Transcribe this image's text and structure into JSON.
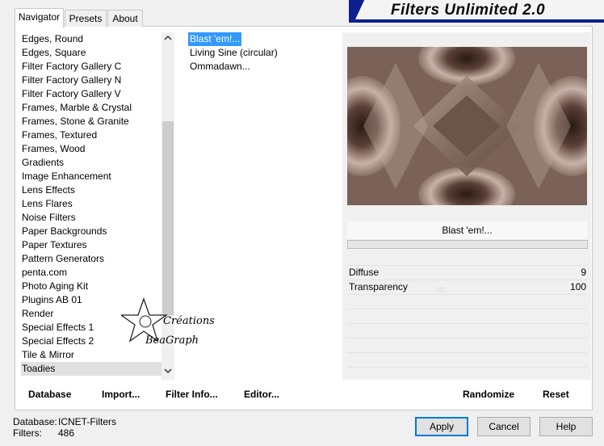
{
  "banner": {
    "title": "Filters Unlimited 2.0"
  },
  "tabs": [
    {
      "label": "Navigator",
      "active": true
    },
    {
      "label": "Presets",
      "active": false
    },
    {
      "label": "About",
      "active": false
    }
  ],
  "categories": [
    "Edges, Round",
    "Edges, Square",
    "Filter Factory Gallery C",
    "Filter Factory Gallery N",
    "Filter Factory Gallery V",
    "Frames, Marble & Crystal",
    "Frames, Stone & Granite",
    "Frames, Textured",
    "Frames, Wood",
    "Gradients",
    "Image Enhancement",
    "Lens Effects",
    "Lens Flares",
    "Noise Filters",
    "Paper Backgrounds",
    "Paper Textures",
    "Pattern Generators",
    "penta.com",
    "Photo Aging Kit",
    "Plugins AB 01",
    "Render",
    "Special Effects 1",
    "Special Effects 2",
    "Tile & Mirror",
    "Toadies"
  ],
  "selected_category": "Toadies",
  "filters": [
    "Blast 'em!...",
    "Living Sine (circular)",
    "Ommadawn..."
  ],
  "selected_filter": "Blast 'em!...",
  "preview": {
    "filter_name": "Blast 'em!..."
  },
  "params": [
    {
      "label": "Diffuse",
      "value": "9"
    },
    {
      "label": "Transparency",
      "value": "100"
    }
  ],
  "buttons": {
    "database": "Database",
    "import": "Import...",
    "filter_info": "Filter Info...",
    "editor": "Editor...",
    "randomize": "Randomize",
    "reset": "Reset",
    "apply": "Apply",
    "cancel": "Cancel",
    "help": "Help"
  },
  "status": {
    "database_label": "Database:",
    "database_value": "ICNET-Filters",
    "filters_label": "Filters:",
    "filters_value": "486"
  },
  "watermark": {
    "line1": "Créations",
    "line2": "BeaGraph"
  },
  "icons": {
    "scroll_up": "chevron-up-icon",
    "scroll_down": "chevron-down-icon",
    "star": "star-outline-icon"
  },
  "colors": {
    "banner_blue": "#0b1f8f",
    "selection_blue": "#3399ff",
    "preview_base": "#6a554b"
  }
}
